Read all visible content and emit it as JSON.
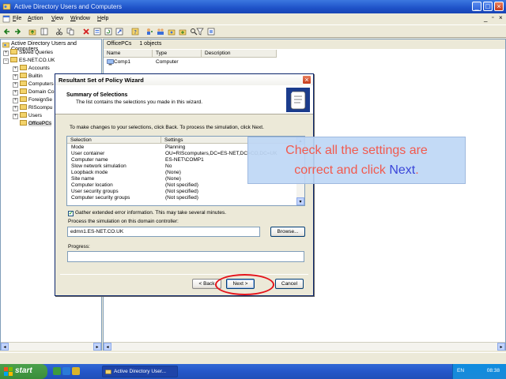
{
  "window": {
    "title": "Active Directory Users and Computers"
  },
  "menu": {
    "items": [
      {
        "u": "F",
        "rest": "ile"
      },
      {
        "u": "A",
        "rest": "ction"
      },
      {
        "u": "V",
        "rest": "iew"
      },
      {
        "u": "W",
        "rest": "indow"
      },
      {
        "u": "H",
        "rest": "elp"
      }
    ]
  },
  "tree": {
    "root": "Active Directory Users and Computers",
    "items": [
      {
        "label": "Saved Queries"
      },
      {
        "label": "ES-NET.CO.UK"
      },
      {
        "label": "Accounts"
      },
      {
        "label": "Builtin"
      },
      {
        "label": "Computers"
      },
      {
        "label": "Domain Co"
      },
      {
        "label": "ForeignSe"
      },
      {
        "label": "RIScompu"
      },
      {
        "label": "Users"
      },
      {
        "label": "OfficePCs"
      }
    ]
  },
  "list": {
    "title": "OfficePCs",
    "count": "1 objects",
    "columns": [
      "Name",
      "Type",
      "Description"
    ],
    "rows": [
      {
        "name": "Comp1",
        "type": "Computer",
        "description": ""
      }
    ]
  },
  "dialog": {
    "title": "Resultant Set of Policy Wizard",
    "heading": "Summary of Selections",
    "subheading": "The list contains the selections you made in this wizard.",
    "instruction": "To make changes to your selections, click Back. To process the simulation, click Next.",
    "columns": [
      "Selection",
      "Settings"
    ],
    "rows": [
      {
        "selection": "Mode",
        "settings": "Planning"
      },
      {
        "selection": "User container",
        "settings": "OU=RIScomputers,DC=ES-NET,DC=CO,DC=UK"
      },
      {
        "selection": "Computer name",
        "settings": "ES-NET\\COMP1"
      },
      {
        "selection": "Slow network simulation",
        "settings": "No"
      },
      {
        "selection": "Loopback mode",
        "settings": "(None)"
      },
      {
        "selection": "Site name",
        "settings": "(None)"
      },
      {
        "selection": "Computer location",
        "settings": "(Not specified)"
      },
      {
        "selection": "User security groups",
        "settings": "(Not specified)"
      },
      {
        "selection": "Computer security groups",
        "settings": "(Not specified)"
      }
    ],
    "checkbox_label": "Gather extended error information. This may take several minutes.",
    "checkbox_checked": true,
    "dc_label": "Process the simulation on this domain controller:",
    "dc_value": "edmn1.ES-NET.CO.UK",
    "browse_label": "Browse...",
    "progress_label": "Progress:",
    "back_label": "< Back",
    "next_label": "Next >",
    "cancel_label": "Cancel"
  },
  "callout": {
    "line1": "Check all the settings are",
    "line2_prefix": "correct and click ",
    "line2_highlight": "Next",
    "line2_suffix": "."
  },
  "taskbar": {
    "start_label": "start",
    "task_label": "Active Directory User...",
    "language": "EN",
    "clock": "08:38"
  },
  "colors": {
    "callout_text": "#f15a4e",
    "callout_highlight": "#3b46d9",
    "highlight_ring": "#e4141b"
  }
}
